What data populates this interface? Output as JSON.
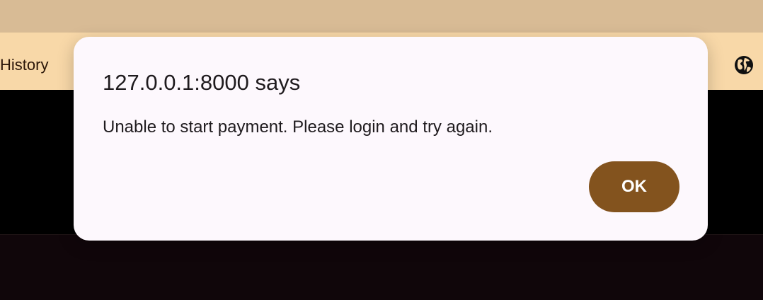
{
  "navbar": {
    "history_label": "History",
    "globe_icon": "globe-icon"
  },
  "dialog": {
    "title": "127.0.0.1:8000 says",
    "message": "Unable to start payment. Please login and try again.",
    "ok_label": "OK"
  },
  "colors": {
    "top_strip": "#d8bb95",
    "navbar_bg": "#f8d8a8",
    "dialog_bg": "#fdf8fd",
    "ok_button_bg": "#83531e",
    "ok_button_text": "#ffffff",
    "page_dark_bg": "#000000"
  }
}
